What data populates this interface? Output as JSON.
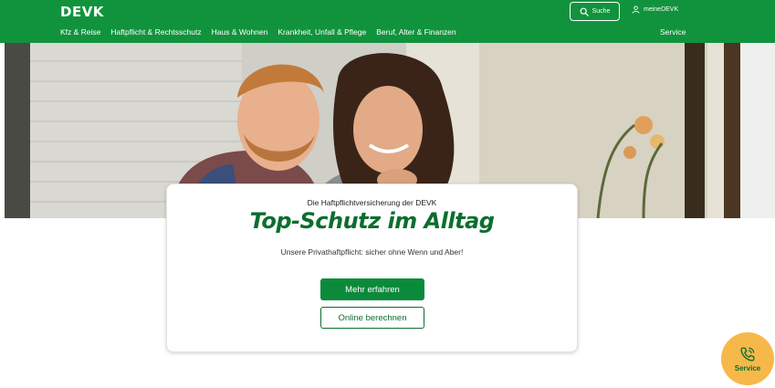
{
  "header": {
    "logo": "DEVK",
    "search_label": "Suche",
    "account_label": "meineDEVK",
    "nav": [
      {
        "label": "Kfz & Reise"
      },
      {
        "label": "Haftpflicht & Rechtsschutz"
      },
      {
        "label": "Haus & Wohnen"
      },
      {
        "label": "Krankheit, Unfall & Pflege"
      },
      {
        "label": "Beruf, Alter & Finanzen"
      }
    ],
    "service_label": "Service"
  },
  "card": {
    "eyebrow": "Die Haftpflichtversicherung der DEVK",
    "title": "Top-Schutz im Alltag",
    "subtitle": "Unsere Privathaftpflicht: sicher ohne Wenn und Aber!",
    "primary_button": "Mehr erfahren",
    "secondary_button": "Online berechnen"
  },
  "fab": {
    "label": "Service",
    "icon": "phone-icon"
  },
  "colors": {
    "brand_green": "#11933d",
    "dark_green": "#0b6e2e",
    "fab_orange": "#f7b84a"
  }
}
